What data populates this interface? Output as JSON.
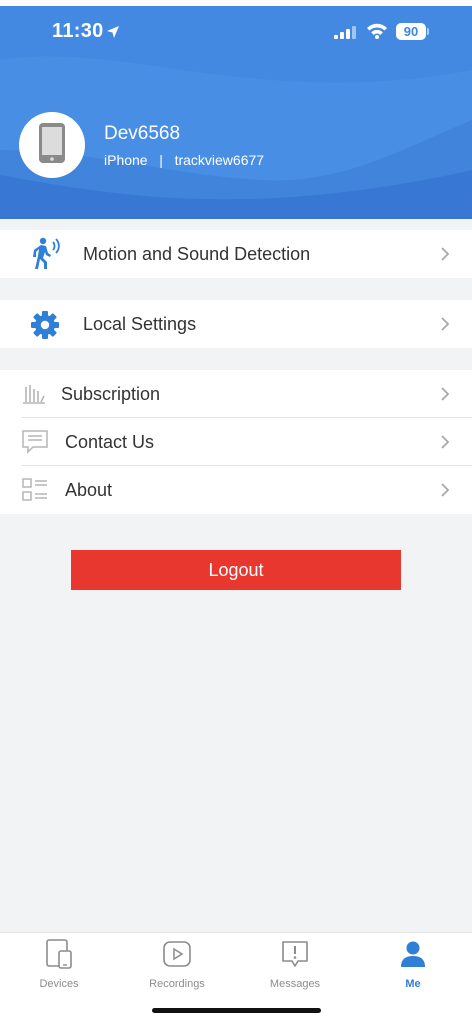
{
  "status_bar": {
    "time": "11:30",
    "battery": "90",
    "icons": [
      "location-arrow-icon",
      "cellular-signal-icon",
      "wifi-icon",
      "battery-icon"
    ]
  },
  "profile": {
    "name": "Dev6568",
    "subtitle": "iPhone   |   trackview6677",
    "avatar_icon": "phone-icon"
  },
  "menu": {
    "motion": {
      "label": "Motion and Sound Detection",
      "icon": "walking-person-icon"
    },
    "local": {
      "label": "Local Settings",
      "icon": "gear-icon"
    },
    "subscription": {
      "label": "Subscription",
      "icon": "subscription-icon"
    },
    "contact": {
      "label": "Contact Us",
      "icon": "chat-icon"
    },
    "about": {
      "label": "About",
      "icon": "list-icon"
    }
  },
  "logout_label": "Logout",
  "tabs": [
    {
      "label": "Devices",
      "icon": "devices-icon",
      "active": false
    },
    {
      "label": "Recordings",
      "icon": "play-icon",
      "active": false
    },
    {
      "label": "Messages",
      "icon": "message-alert-icon",
      "active": false
    },
    {
      "label": "Me",
      "icon": "person-icon",
      "active": true
    }
  ],
  "colors": {
    "header_blue": "#3f86e0",
    "accent_blue": "#2f7fd6",
    "logout_red": "#e8372f",
    "background": "#f2f3f5"
  }
}
